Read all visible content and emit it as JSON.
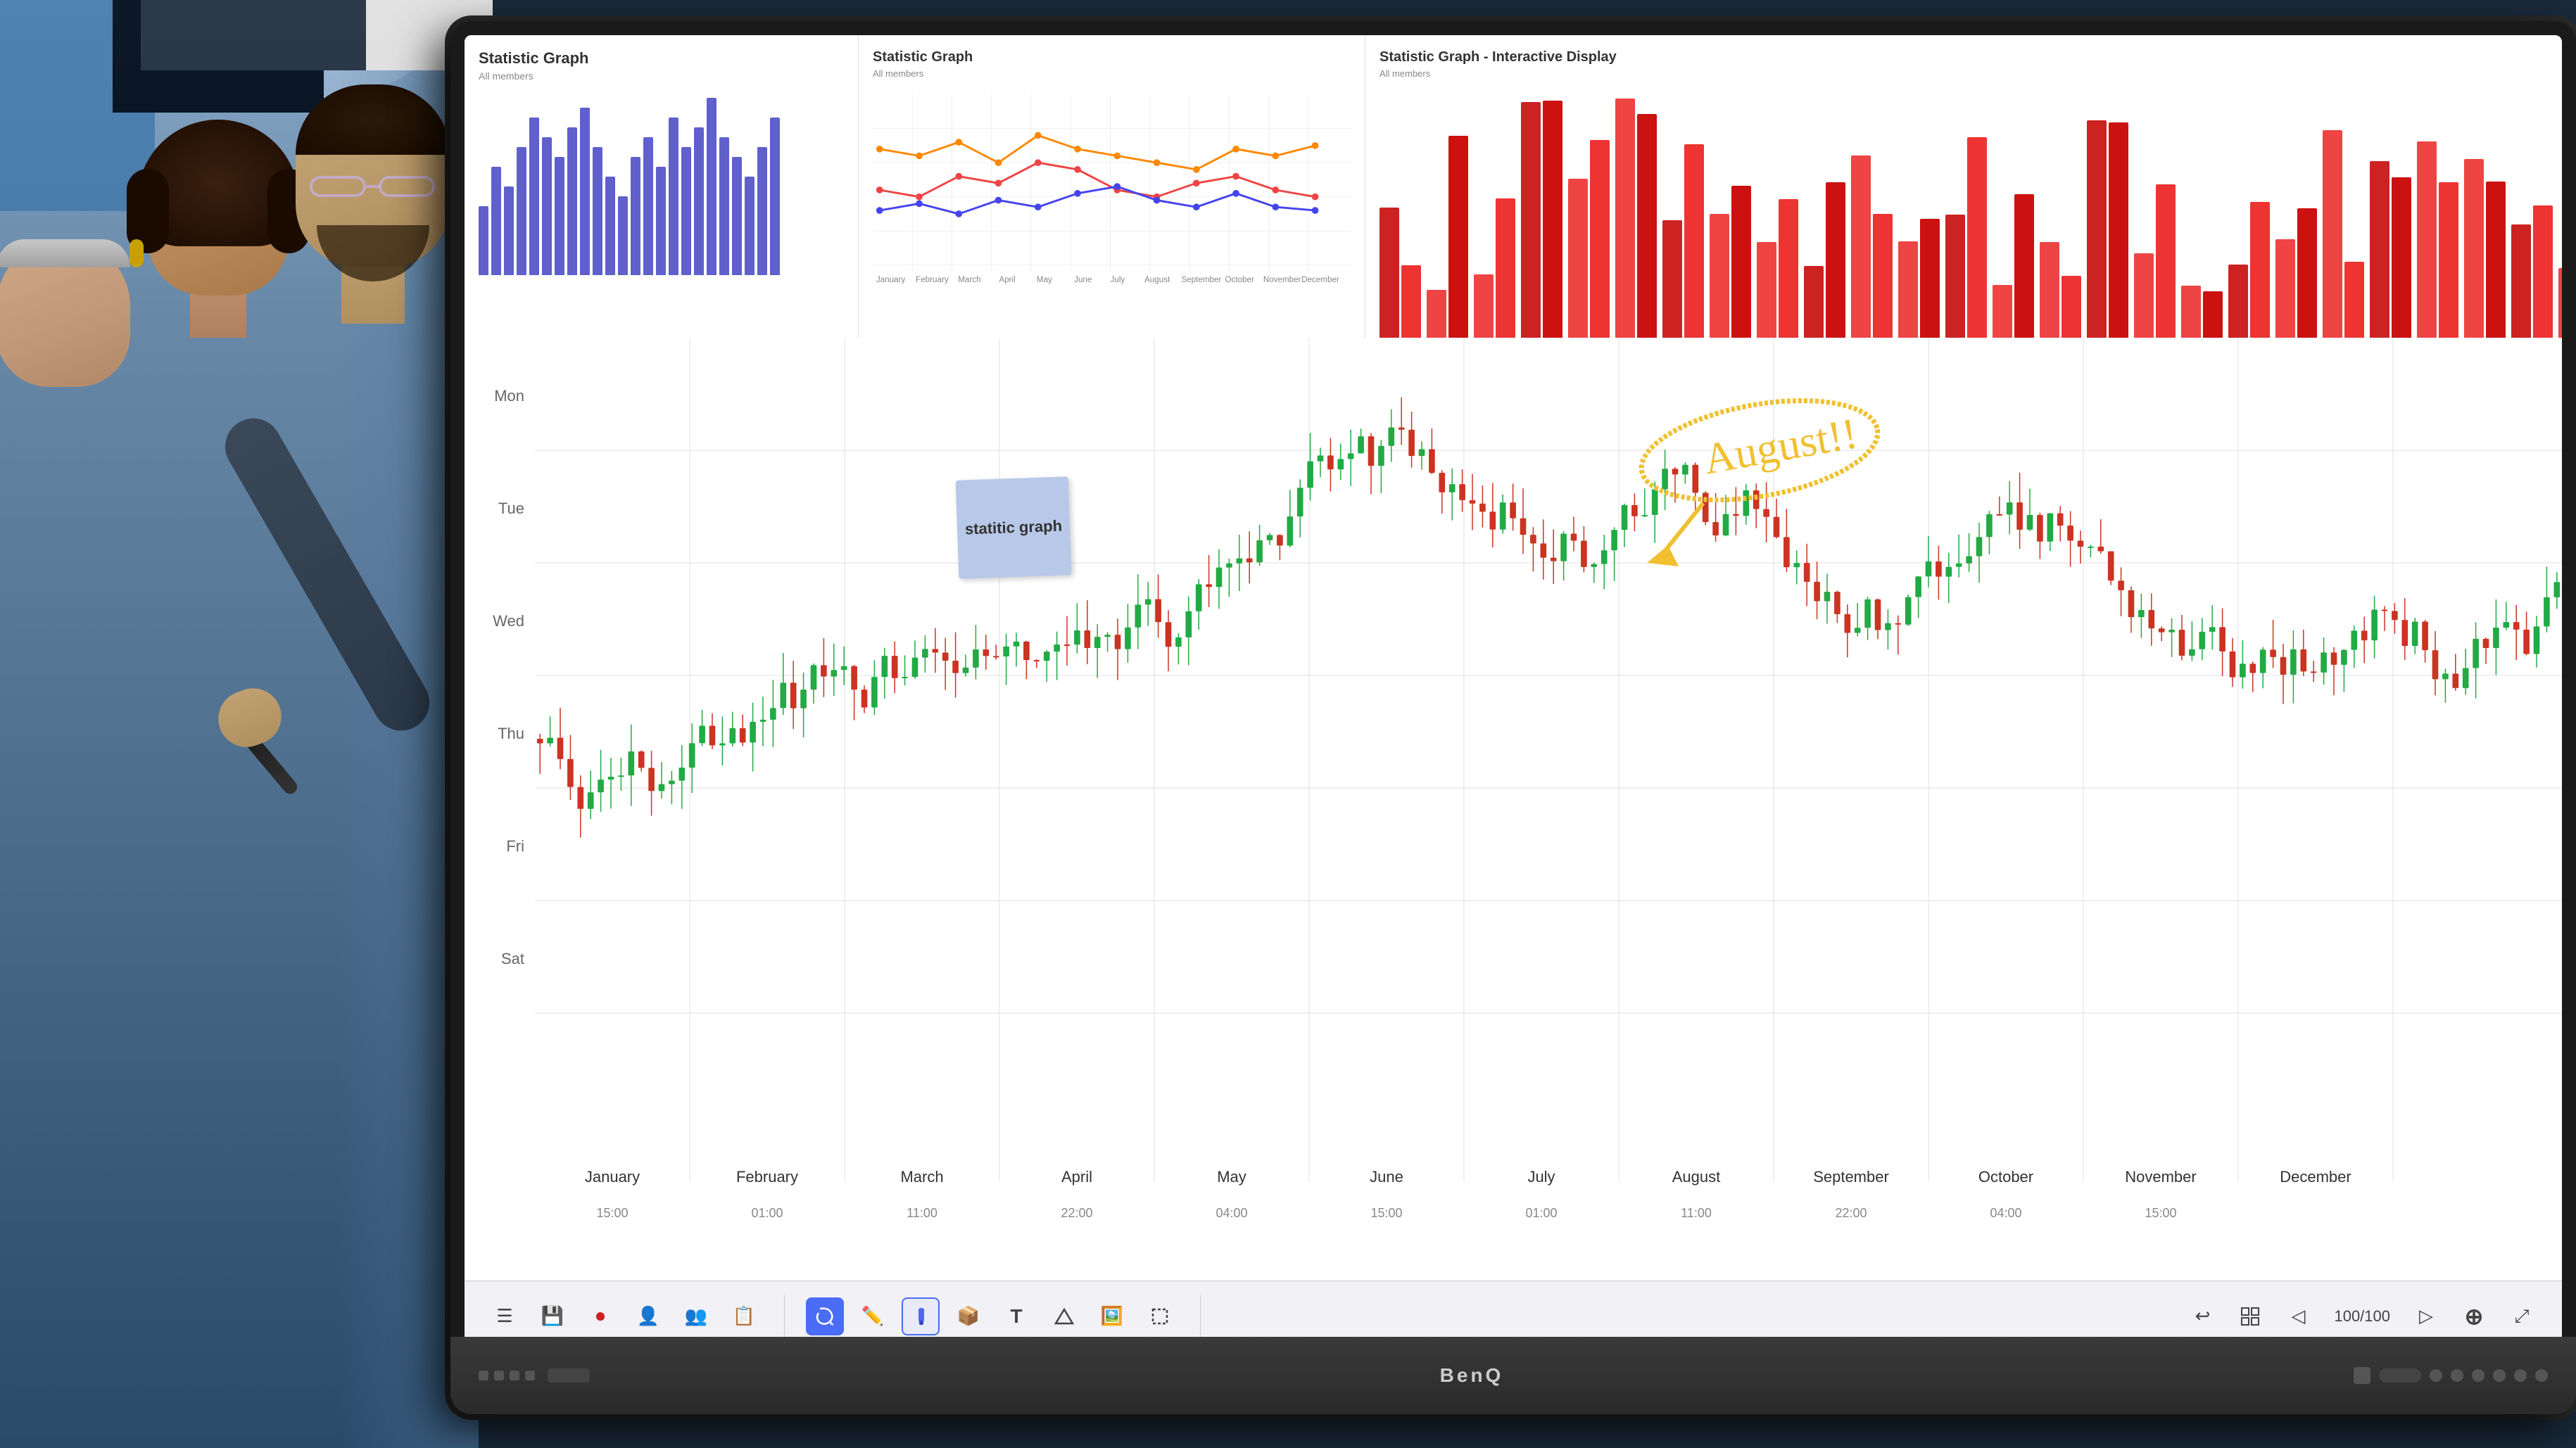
{
  "app": {
    "title": "Statistic Graph - Interactive Display",
    "brand": "BenQ"
  },
  "background": {
    "room_color": "#6a8aaa",
    "wall_color": "#5a7a9a"
  },
  "screen": {
    "chart1": {
      "title": "Statistic Graph",
      "subtitle": "All members",
      "bar_color": "#6060cc",
      "bars": [
        35,
        55,
        45,
        65,
        80,
        70,
        60,
        75,
        85,
        65,
        50,
        40,
        60,
        70,
        55,
        80,
        65,
        75,
        90,
        70,
        60,
        50,
        65,
        80
      ]
    },
    "chart2": {
      "title": "Statistic Graph",
      "months": [
        "January",
        "February",
        "March",
        "April",
        "May",
        "June",
        "July",
        "August",
        "September",
        "October",
        "November",
        "December"
      ],
      "lines": [
        {
          "color": "#ee4444",
          "data": [
            60,
            55,
            70,
            65,
            80,
            75,
            60,
            55,
            65,
            70,
            60,
            55
          ]
        },
        {
          "color": "#4444ee",
          "data": [
            40,
            50,
            45,
            60,
            55,
            65,
            70,
            60,
            55,
            65,
            50,
            45
          ]
        },
        {
          "color": "#ff8800",
          "data": [
            80,
            75,
            85,
            70,
            90,
            80,
            75,
            70,
            65,
            80,
            75,
            85
          ]
        }
      ]
    },
    "main_chart": {
      "y_labels": [
        "Mon",
        "Tue",
        "Wed",
        "Thu",
        "Fri",
        "Sat"
      ],
      "x_months": [
        "January",
        "February",
        "March",
        "April",
        "May",
        "June",
        "July",
        "August",
        "September",
        "October",
        "November",
        "December"
      ],
      "x_times": [
        "15:00",
        "01:00",
        "11:00",
        "22:00",
        "04:00",
        "15:00",
        "01:00",
        "11:00",
        "22:00",
        "04:00",
        "15:00"
      ],
      "sticky_note": {
        "text": "statitic\ngraph",
        "bg_color": "#b8c8e8"
      },
      "annotation": {
        "text": "August!!",
        "color": "#f0c030"
      }
    },
    "toolbar": {
      "page_count": "100/100",
      "buttons": [
        "≡",
        "💾",
        "⏺",
        "👤",
        "👥",
        "📋",
        "✏️",
        "🖊️",
        "📦",
        "T",
        "△",
        "🖼️",
        "📎",
        "↩",
        "⊞",
        "◁",
        "▷",
        "⊕",
        "⤢"
      ]
    }
  }
}
